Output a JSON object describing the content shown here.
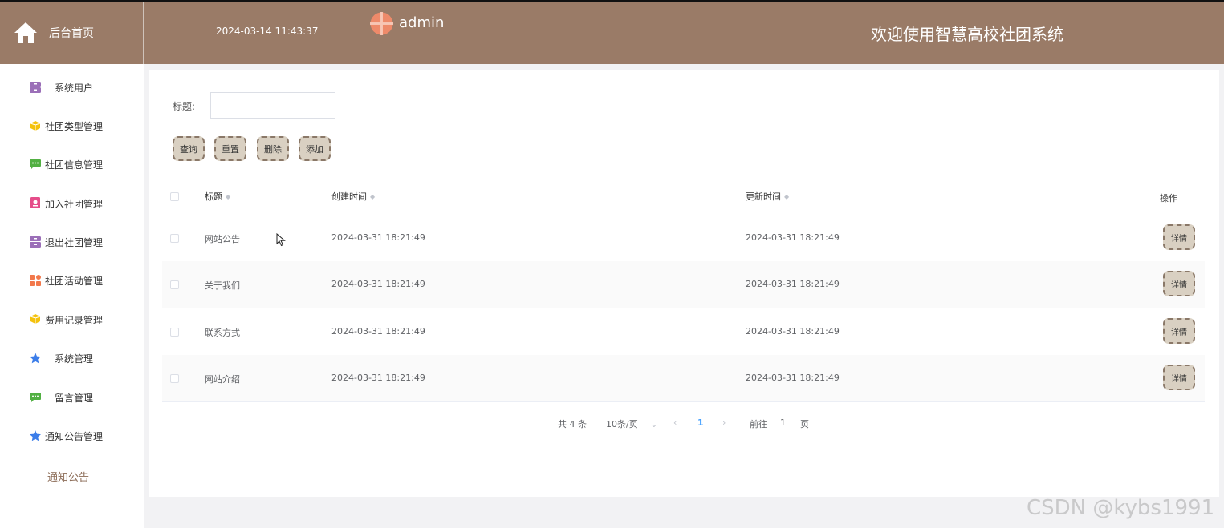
{
  "header": {
    "brand_label": "后台首页",
    "datetime": "2024-03-14 11:43:37",
    "username": "admin",
    "welcome": "欢迎使用智慧高校社团系统",
    "bg_color": "#9a7b67"
  },
  "sidebar": {
    "items": [
      {
        "label": "系统用户",
        "icon": "archive-icon",
        "color": "#9b6fb8"
      },
      {
        "label": "社团类型管理",
        "icon": "cube-icon",
        "color": "#f4c20d"
      },
      {
        "label": "社团信息管理",
        "icon": "chat-icon",
        "color": "#52b043"
      },
      {
        "label": "加入社团管理",
        "icon": "badge-icon",
        "color": "#e54d8a"
      },
      {
        "label": "退出社团管理",
        "icon": "archive-icon",
        "color": "#9b6fb8"
      },
      {
        "label": "社团活动管理",
        "icon": "apps-icon",
        "color": "#f2784b"
      },
      {
        "label": "费用记录管理",
        "icon": "cube-icon",
        "color": "#f4c20d"
      },
      {
        "label": "系统管理",
        "icon": "star-icon",
        "color": "#3b7de9"
      },
      {
        "label": "留言管理",
        "icon": "chat-icon",
        "color": "#52b043"
      },
      {
        "label": "通知公告管理",
        "icon": "star-icon",
        "color": "#3b7de9"
      }
    ],
    "sub_item": "通知公告"
  },
  "search": {
    "label": "标题:",
    "value": "",
    "placeholder": ""
  },
  "toolbar": {
    "query": "查询",
    "reset": "重置",
    "delete": "删除",
    "add": "添加"
  },
  "table": {
    "headers": {
      "title": "标题",
      "created": "创建时间",
      "updated": "更新时间",
      "action": "操作"
    },
    "rows": [
      {
        "title": "网站公告",
        "created": "2024-03-31 18:21:49",
        "updated": "2024-03-31 18:21:49",
        "action": "详情"
      },
      {
        "title": "关于我们",
        "created": "2024-03-31 18:21:49",
        "updated": "2024-03-31 18:21:49",
        "action": "详情"
      },
      {
        "title": "联系方式",
        "created": "2024-03-31 18:21:49",
        "updated": "2024-03-31 18:21:49",
        "action": "详情"
      },
      {
        "title": "网站介绍",
        "created": "2024-03-31 18:21:49",
        "updated": "2024-03-31 18:21:49",
        "action": "详情"
      }
    ]
  },
  "pagination": {
    "total": "共 4 条",
    "page_size": "10条/页",
    "current_page": "1",
    "goto_prefix": "前往",
    "goto_value": "1",
    "goto_suffix": "页",
    "active_color": "#409eff"
  },
  "watermark": "CSDN @kybs1991"
}
